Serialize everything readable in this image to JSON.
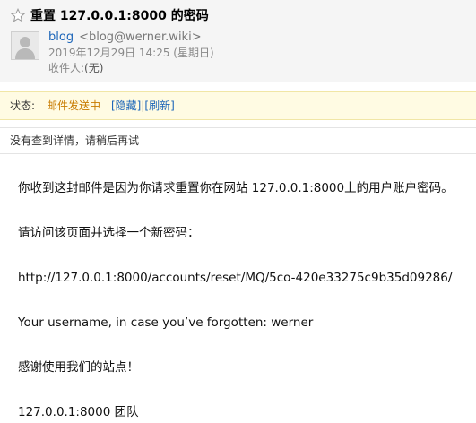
{
  "header": {
    "subject": "重置 127.0.0.1:8000 的密码",
    "sender_name": "blog",
    "sender_email": "<blog@werner.wiki>",
    "date": "2019年12月29日 14:25 (星期日)",
    "recipient_label": "收件人:",
    "recipient_value": "(无)"
  },
  "status_bar": {
    "label": "状态:",
    "value": "邮件发送中",
    "hide_link": "[隐藏]",
    "separator": "|",
    "refresh_link": "[刷新]"
  },
  "notice": {
    "text": "没有查到详情，请稍后再试"
  },
  "email_body": {
    "line1": "你收到这封邮件是因为你请求重置你在网站 127.0.0.1:8000上的用户账户密码。",
    "line2": "请访问该页面并选择一个新密码：",
    "line3": "http://127.0.0.1:8000/accounts/reset/MQ/5co-420e33275c9b35d09286/",
    "line4": "Your username, in case you’ve forgotten: werner",
    "line5": "感谢使用我们的站点！",
    "line6": "127.0.0.1:8000 团队"
  },
  "icons": {
    "star": "star-outline-icon",
    "avatar": "default-avatar-icon"
  },
  "colors": {
    "link": "#1a64b8",
    "status_value": "#c87b00",
    "status_background": "#fffbe3",
    "header_background": "#f5f5f5"
  }
}
